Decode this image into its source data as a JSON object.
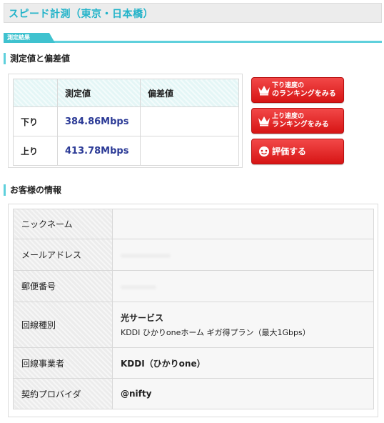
{
  "page": {
    "title": "スピード計測（東京・日本橋）"
  },
  "tab": {
    "label": "測定結果"
  },
  "measurement": {
    "heading": "測定値と偏差値",
    "columns": [
      "",
      "測定値",
      "偏差値"
    ],
    "rows": [
      {
        "label": "下り",
        "value": "384.86Mbps",
        "deviation": ""
      },
      {
        "label": "上り",
        "value": "413.78Mbps",
        "deviation": ""
      }
    ]
  },
  "buttons": {
    "down_ranking": {
      "line1": "下り速度の",
      "line2": "のランキングをみる"
    },
    "up_ranking": {
      "line1": "上り速度の",
      "line2": "ランキングをみる"
    },
    "rate": {
      "label": "評価する"
    }
  },
  "customer": {
    "heading": "お客様の情報",
    "rows": [
      {
        "key": "ニックネーム",
        "value": ""
      },
      {
        "key": "メールアドレス",
        "value": ""
      },
      {
        "key": "郵便番号",
        "value": ""
      },
      {
        "key": "回線種別",
        "value": "光サービス",
        "value2": "KDDI ひかりoneホーム ギガ得プラン（最大1Gbps）"
      },
      {
        "key": "回線事業者",
        "value": "KDDI（ひかりone）"
      },
      {
        "key": "契約プロバイダ",
        "value": "@nifty"
      }
    ]
  },
  "colors": {
    "accent": "#22b3c9",
    "tab": "#3fc2cf",
    "button_red": "#d71515",
    "value_blue": "#2b3a96"
  }
}
